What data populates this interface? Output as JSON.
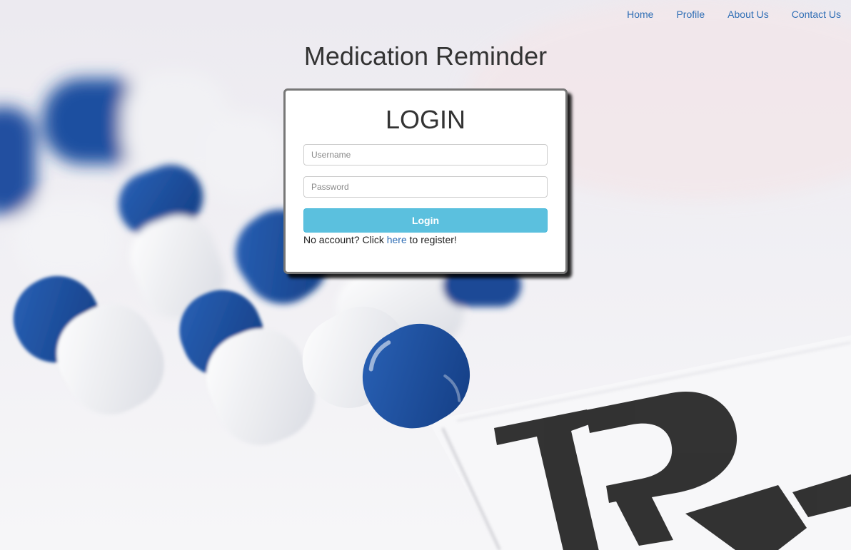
{
  "nav": {
    "items": [
      {
        "label": "Home"
      },
      {
        "label": "Profile"
      },
      {
        "label": "About Us"
      },
      {
        "label": "Contact Us"
      }
    ]
  },
  "header": {
    "title": "Medication Reminder"
  },
  "login": {
    "title": "LOGIN",
    "username_placeholder": "Username",
    "password_placeholder": "Password",
    "submit_label": "Login",
    "register_prefix": "No account? Click ",
    "register_link": "here",
    "register_suffix": " to register!"
  },
  "colors": {
    "link": "#2f6eb5",
    "button": "#5bc0de",
    "capsule_blue": "#1d4f9c"
  }
}
